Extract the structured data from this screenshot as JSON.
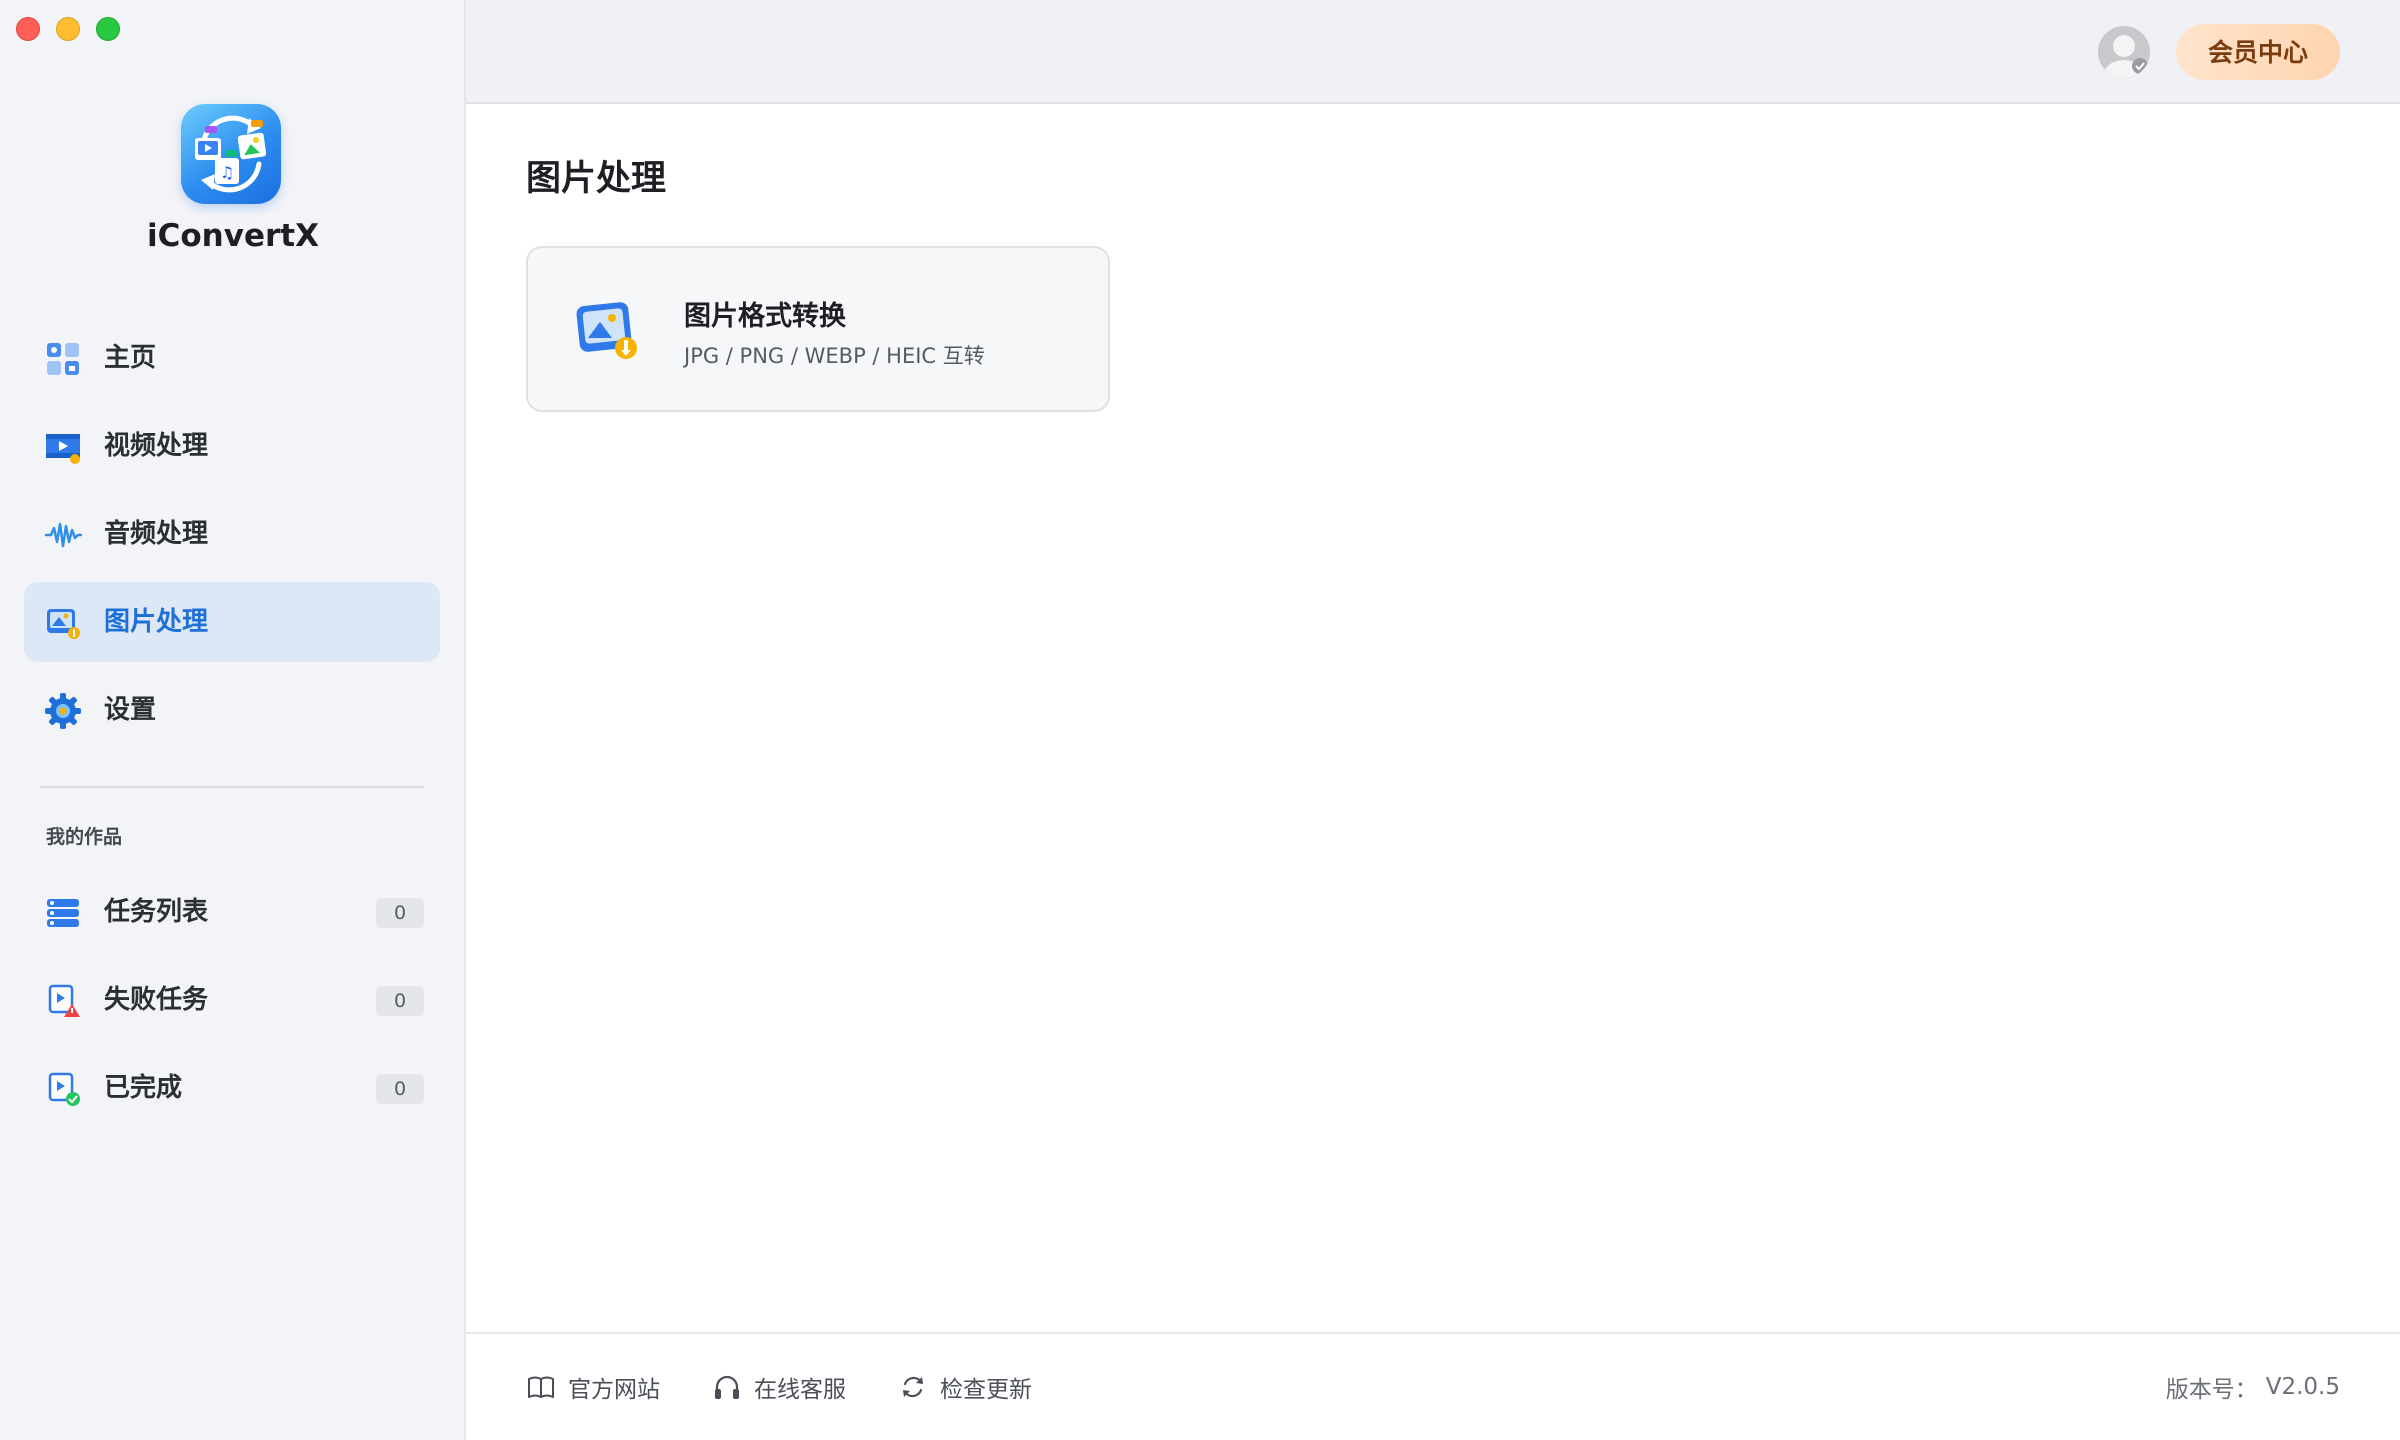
{
  "app": {
    "name": "iConvertX"
  },
  "sidebar": {
    "items": [
      {
        "label": "主页",
        "icon": "home-grid-icon"
      },
      {
        "label": "视频处理",
        "icon": "video-icon"
      },
      {
        "label": "音频处理",
        "icon": "audio-wave-icon"
      },
      {
        "label": "图片处理",
        "icon": "image-icon",
        "active": true
      },
      {
        "label": "设置",
        "icon": "gear-icon"
      }
    ],
    "section_title": "我的作品",
    "works": [
      {
        "label": "任务列表",
        "count": "0",
        "icon": "task-list-icon"
      },
      {
        "label": "失败任务",
        "count": "0",
        "icon": "failed-task-icon"
      },
      {
        "label": "已完成",
        "count": "0",
        "icon": "completed-icon"
      }
    ]
  },
  "topbar": {
    "vip_label": "会员中心"
  },
  "main": {
    "title": "图片处理",
    "card": {
      "title": "图片格式转换",
      "description": "JPG / PNG / WEBP / HEIC 互转"
    }
  },
  "footer": {
    "links": [
      {
        "label": "官方网站",
        "icon": "book-icon"
      },
      {
        "label": "在线客服",
        "icon": "headphones-icon"
      },
      {
        "label": "检查更新",
        "icon": "refresh-icon"
      }
    ],
    "version_label": "版本号：",
    "version_value": "V2.0.5"
  },
  "colors": {
    "accent": "#1f6fd8",
    "sidebar_bg": "#f3f4f8",
    "active_item_bg": "#dde8f7",
    "vip_bg": "#ffd9b8",
    "vip_text": "#7a3d10"
  }
}
